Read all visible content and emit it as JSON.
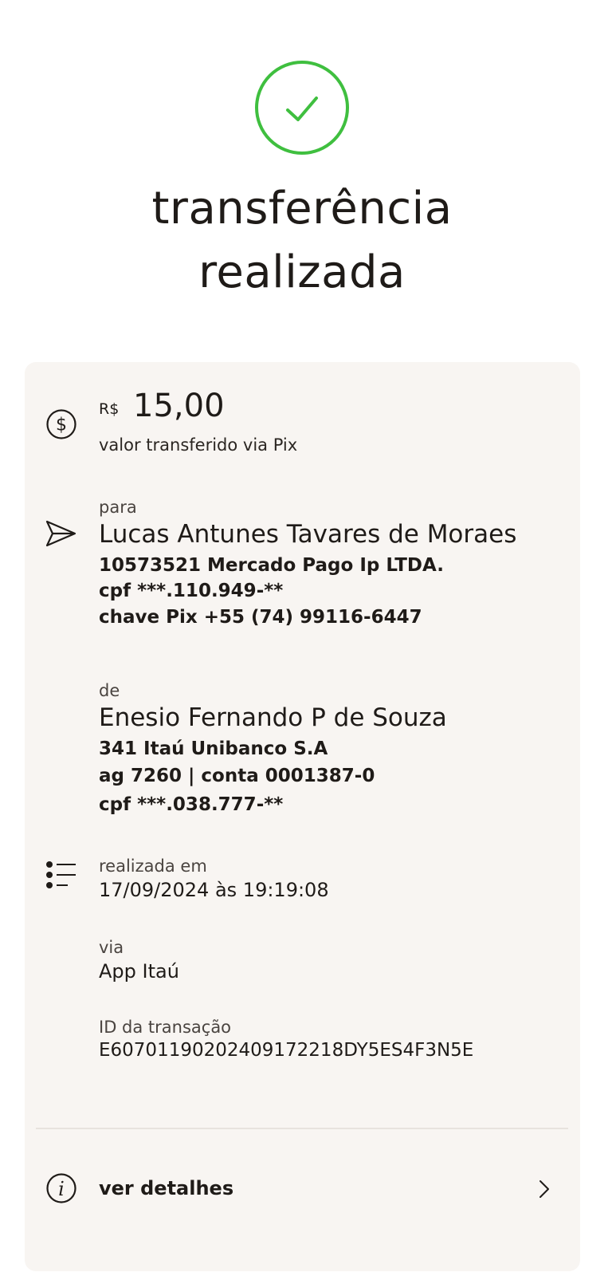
{
  "header": {
    "status_icon": "check-icon",
    "status_color": "#3fbf3f",
    "title_line1": "transferência",
    "title_line2": "realizada"
  },
  "amount": {
    "icon": "dollar-circle-icon",
    "currency": "R$",
    "value": "15,00",
    "caption": "valor transferido via Pix"
  },
  "recipient": {
    "icon": "send-icon",
    "label": "para",
    "name": "Lucas Antunes Tavares de Moraes",
    "bank": "10573521 Mercado Pago Ip LTDA.",
    "cpf": "cpf ***.110.949-**",
    "pix_key": "chave Pix +55 (74) 99116-6447"
  },
  "sender": {
    "label": "de",
    "name": "Enesio Fernando P de Souza",
    "bank": "341 Itaú Unibanco S.A",
    "account": "ag 7260 | conta 0001387-0",
    "cpf": "cpf ***.038.777-**"
  },
  "info": {
    "icon": "list-icon",
    "date_label": "realizada em",
    "date_value": "17/09/2024 às 19:19:08",
    "via_label": "via",
    "via_value": "App Itaú",
    "id_label": "ID da transação",
    "id_value": "E60701190202409172218DY5ES4F3N5E"
  },
  "details": {
    "icon": "info-icon",
    "label": "ver detalhes",
    "chevron": "chevron-right-icon"
  }
}
